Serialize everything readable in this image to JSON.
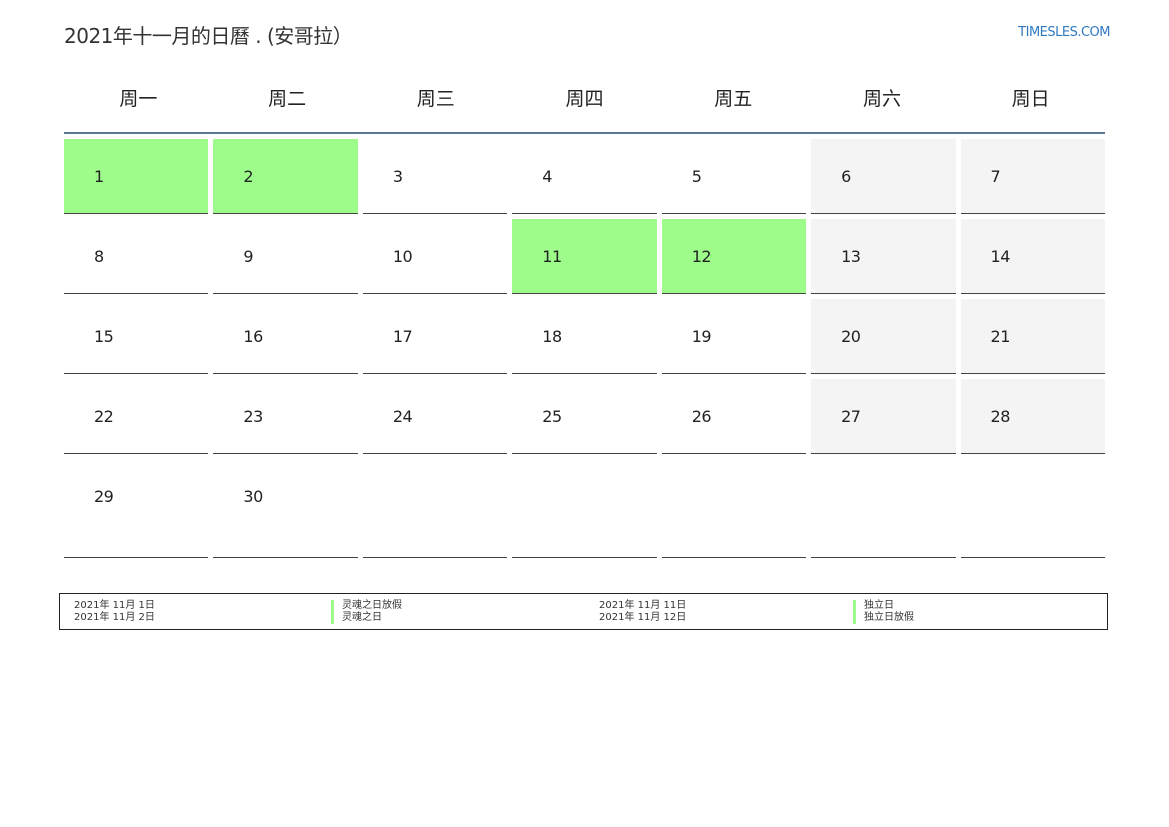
{
  "header": {
    "title": "2021年十一月的日曆 . (安哥拉）",
    "site": "TIMESLES.COM"
  },
  "weekdays": [
    "周一",
    "周二",
    "周三",
    "周四",
    "周五",
    "周六",
    "周日"
  ],
  "weeks": [
    [
      "1",
      "2",
      "3",
      "4",
      "5",
      "6",
      "7"
    ],
    [
      "8",
      "9",
      "10",
      "11",
      "12",
      "13",
      "14"
    ],
    [
      "15",
      "16",
      "17",
      "18",
      "19",
      "20",
      "21"
    ],
    [
      "22",
      "23",
      "24",
      "25",
      "26",
      "27",
      "28"
    ],
    [
      "29",
      "30",
      "",
      "",
      "",
      "",
      ""
    ]
  ],
  "colors": {
    "holiday": "#9dfc8a",
    "weekend": "#f4f4f4",
    "header_rule": "#5b7796",
    "link": "#2f7ac0"
  },
  "legend": {
    "left": [
      {
        "date": "2021年 11月 1日",
        "name": "灵魂之日放假"
      },
      {
        "date": "2021年 11月 2日",
        "name": "灵魂之日"
      }
    ],
    "right": [
      {
        "date": "2021年 11月 11日",
        "name": "独立日"
      },
      {
        "date": "2021年 11月 12日",
        "name": "独立日放假"
      }
    ]
  }
}
